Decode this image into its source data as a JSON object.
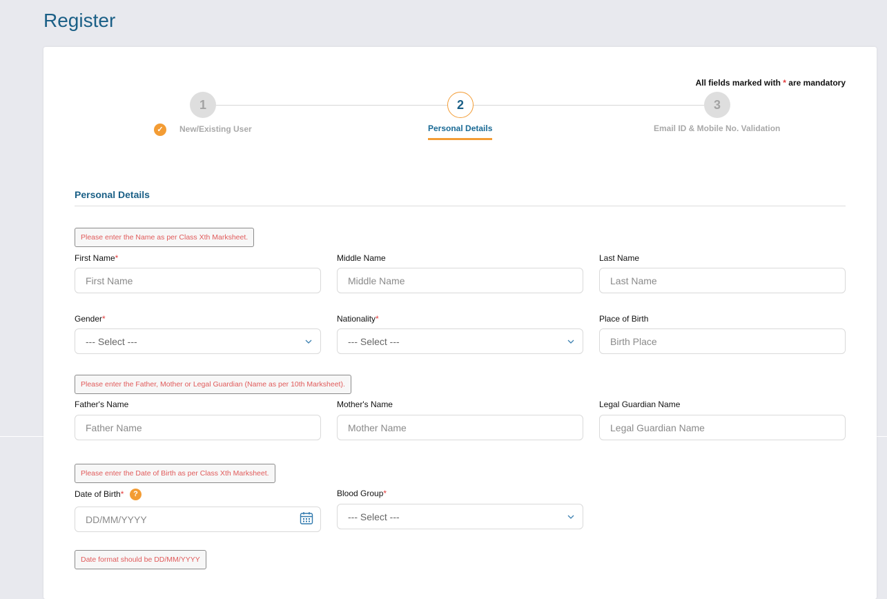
{
  "page": {
    "title": "Register"
  },
  "mandatory_note": {
    "prefix": "All fields marked with",
    "star": "*",
    "suffix": "are mandatory"
  },
  "stepper": {
    "steps": [
      {
        "number": "1",
        "label": "New/Existing User",
        "state": "completed"
      },
      {
        "number": "2",
        "label": "Personal Details",
        "state": "active"
      },
      {
        "number": "3",
        "label": "Email ID & Mobile No. Validation",
        "state": "pending"
      }
    ]
  },
  "section": {
    "title": "Personal Details"
  },
  "notes": {
    "name": "Please enter the Name as per Class Xth Marksheet.",
    "parents": "Please enter the Father, Mother or Legal Guardian (Name as per 10th Marksheet).",
    "dob": "Please enter the Date of Birth as per Class Xth Marksheet.",
    "date_format": "Date format should be DD/MM/YYYY"
  },
  "fields": {
    "first_name": {
      "label": "First Name",
      "required": "*",
      "placeholder": "First Name"
    },
    "middle_name": {
      "label": "Middle Name",
      "placeholder": "Middle Name"
    },
    "last_name": {
      "label": "Last Name",
      "placeholder": "Last Name"
    },
    "gender": {
      "label": "Gender",
      "required": "*",
      "value": "--- Select ---"
    },
    "nationality": {
      "label": "Nationality",
      "required": "*",
      "value": "--- Select ---"
    },
    "place_of_birth": {
      "label": "Place of Birth",
      "placeholder": "Birth Place"
    },
    "father_name": {
      "label": "Father's Name",
      "placeholder": "Father Name"
    },
    "mother_name": {
      "label": "Mother's Name",
      "placeholder": "Mother Name"
    },
    "guardian_name": {
      "label": "Legal Guardian Name",
      "placeholder": "Legal Guardian Name"
    },
    "dob": {
      "label": "Date of Birth",
      "required": "*",
      "help": "?",
      "placeholder": "DD/MM/YYYY"
    },
    "blood_group": {
      "label": "Blood Group",
      "required": "*",
      "value": "--- Select ---"
    }
  },
  "colors": {
    "accent": "#f39c34",
    "primary": "#1a5f86",
    "error_text": "#e05a5a",
    "page_bg": "#e8e9ee"
  }
}
